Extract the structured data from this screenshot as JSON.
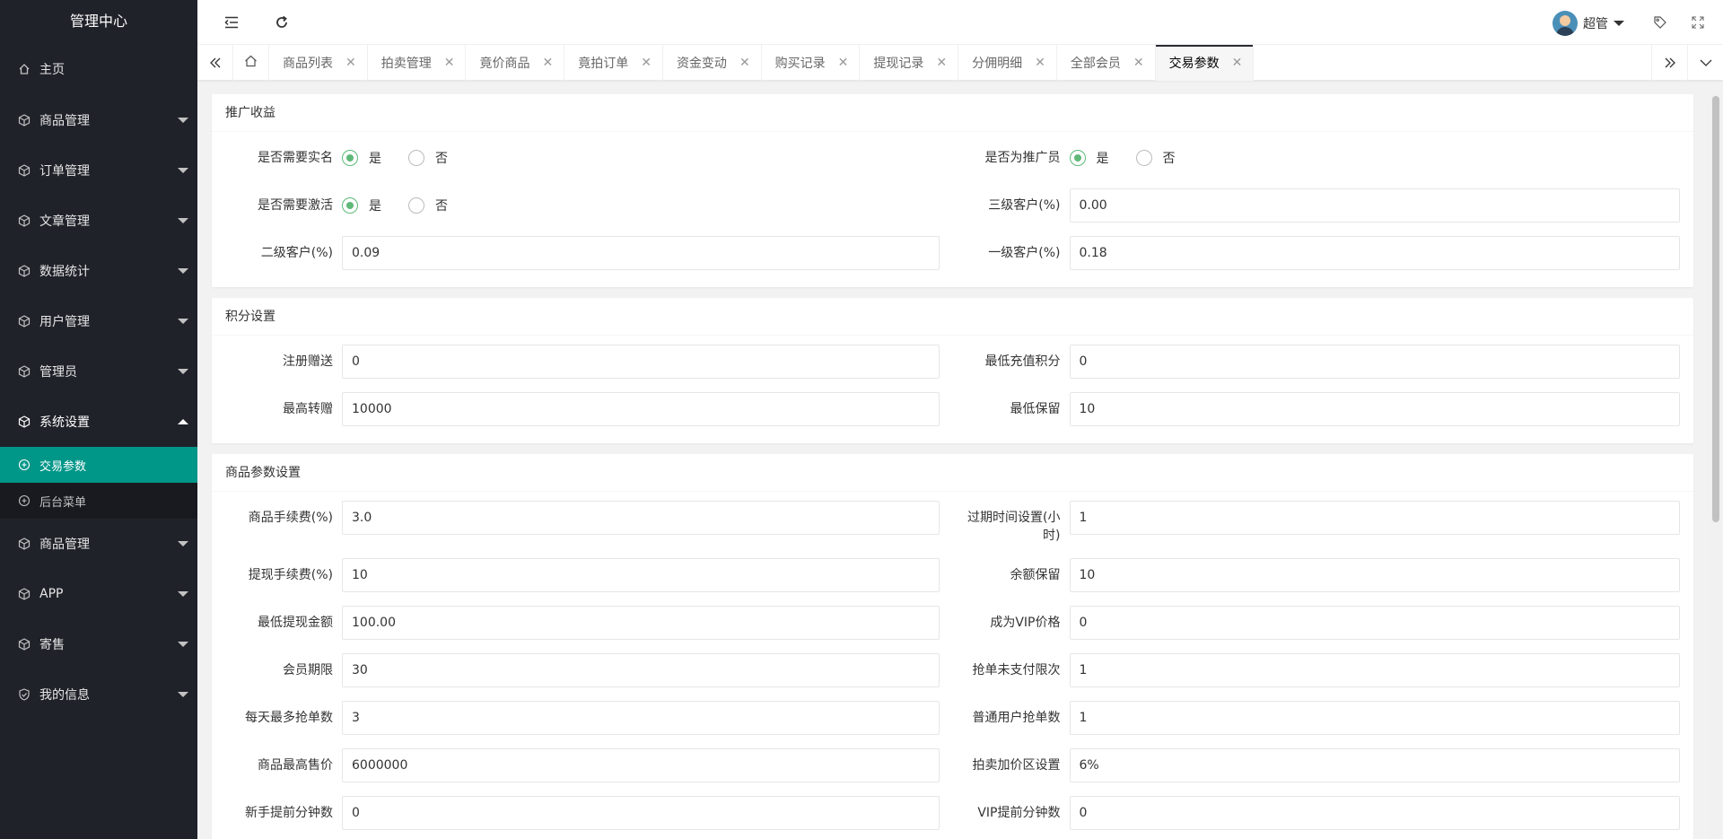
{
  "brand": "管理中心",
  "sidebar": {
    "items": [
      {
        "label": "主页",
        "icon": "home-icon"
      },
      {
        "label": "商品管理",
        "icon": "cube-icon"
      },
      {
        "label": "订单管理",
        "icon": "cube-icon"
      },
      {
        "label": "文章管理",
        "icon": "cube-icon"
      },
      {
        "label": "数据统计",
        "icon": "cube-icon"
      },
      {
        "label": "用户管理",
        "icon": "cube-icon"
      },
      {
        "label": "管理员",
        "icon": "cube-icon"
      },
      {
        "label": "系统设置",
        "icon": "cube-icon"
      },
      {
        "label": "商品管理",
        "icon": "cube-icon"
      },
      {
        "label": "APP",
        "icon": "cube-icon"
      },
      {
        "label": "寄售",
        "icon": "cube-icon"
      },
      {
        "label": "我的信息",
        "icon": "shield-icon"
      }
    ],
    "sub_items": [
      {
        "label": "交易参数",
        "icon": "plus-circle-icon",
        "active": true
      },
      {
        "label": "后台菜单",
        "icon": "plus-circle-icon",
        "active": false
      }
    ]
  },
  "header": {
    "user_name": "超管"
  },
  "tabs": [
    {
      "label": "商品列表"
    },
    {
      "label": "拍卖管理"
    },
    {
      "label": "竟价商品"
    },
    {
      "label": "竟拍订单"
    },
    {
      "label": "资金变动"
    },
    {
      "label": "购买记录"
    },
    {
      "label": "提现记录"
    },
    {
      "label": "分佣明细"
    },
    {
      "label": "全部会员"
    },
    {
      "label": "交易参数",
      "active": true
    }
  ],
  "cards": {
    "promo": {
      "title": "推广收益",
      "realname": {
        "label": "是否需要实名",
        "yes": "是",
        "no": "否",
        "selected": "是"
      },
      "promoter": {
        "label": "是否为推广员",
        "yes": "是",
        "no": "否",
        "selected": "是"
      },
      "activate": {
        "label": "是否需要激活",
        "yes": "是",
        "no": "否",
        "selected": "是"
      },
      "level3": {
        "label": "三级客户(%)",
        "value": "0.00"
      },
      "level2": {
        "label": "二级客户(%)",
        "value": "0.09"
      },
      "level1": {
        "label": "一级客户(%)",
        "value": "0.18"
      }
    },
    "points": {
      "title": "积分设置",
      "register_gift": {
        "label": "注册赠送",
        "value": "0"
      },
      "min_recharge": {
        "label": "最低充值积分",
        "value": "0"
      },
      "max_transfer": {
        "label": "最高转赠",
        "value": "10000"
      },
      "min_reserve": {
        "label": "最低保留",
        "value": "10"
      }
    },
    "goods": {
      "title": "商品参数设置",
      "fee": {
        "label": "商品手续费(%)",
        "value": "3.0"
      },
      "expire": {
        "label": "过期时间设置(小时)",
        "value": "1"
      },
      "withdraw_fee": {
        "label": "提现手续费(%)",
        "value": "10"
      },
      "balance_reserve": {
        "label": "余额保留",
        "value": "10"
      },
      "min_withdraw": {
        "label": "最低提现金额",
        "value": "100.00"
      },
      "vip_price": {
        "label": "成为VIP价格",
        "value": "0"
      },
      "member_period": {
        "label": "会员期限",
        "value": "30"
      },
      "unpaid_limit": {
        "label": "抢单未支付限次",
        "value": "1"
      },
      "daily_max": {
        "label": "每天最多抢单数",
        "value": "3"
      },
      "normal_grab": {
        "label": "普通用户抢单数",
        "value": "1"
      },
      "max_price": {
        "label": "商品最高售价",
        "value": "6000000"
      },
      "markup": {
        "label": "拍卖加价区设置",
        "value": "6%"
      },
      "newbie_advance": {
        "label": "新手提前分钟数",
        "value": "0"
      },
      "vip_advance": {
        "label": "VIP提前分钟数",
        "value": "0"
      }
    }
  }
}
